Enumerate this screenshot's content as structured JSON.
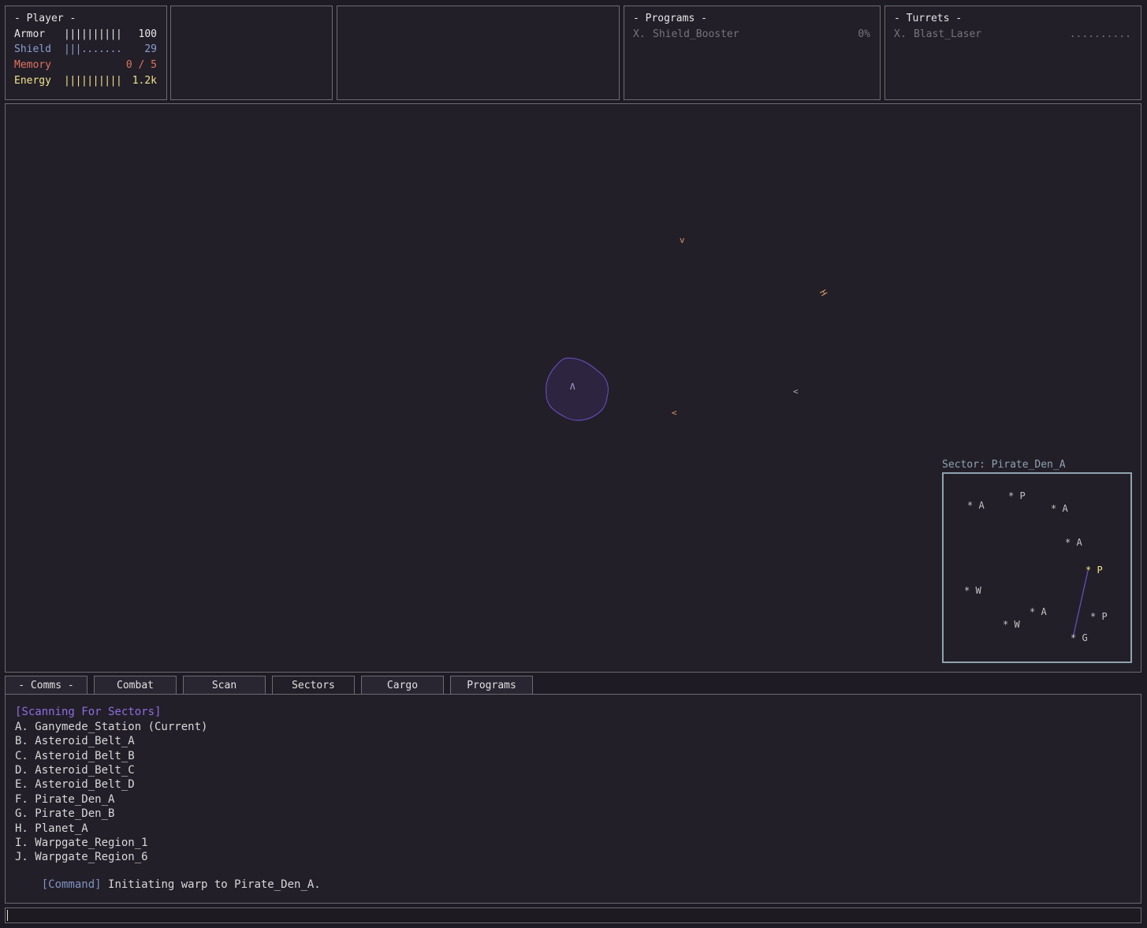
{
  "player_panel": {
    "title": "- Player -",
    "stats": [
      {
        "label": "Armor",
        "bar": "||||||||||",
        "value": "100"
      },
      {
        "label": "Shield",
        "bar": "|||.......",
        "value": "29"
      },
      {
        "label": "Memory",
        "bar": "",
        "value": "0 / 5"
      },
      {
        "label": "Energy",
        "bar": "||||||||||",
        "value": "1.2k"
      }
    ]
  },
  "programs_panel": {
    "title": "- Programs -",
    "items": [
      {
        "key": "X.",
        "name": "Shield_Booster",
        "value": "0%"
      }
    ]
  },
  "turrets_panel": {
    "title": "- Turrets -",
    "items": [
      {
        "key": "X.",
        "name": "Blast_Laser",
        "value": ".........."
      }
    ]
  },
  "viewport": {
    "player_glyph": "Λ",
    "entities": [
      {
        "glyph": "v",
        "label": "ship-1"
      },
      {
        "glyph": "H",
        "label": "ship-2"
      },
      {
        "glyph": "<",
        "label": "ship-3"
      },
      {
        "glyph": "<",
        "label": "ship-4"
      }
    ]
  },
  "minimap": {
    "sector_label": "Sector: Pirate_Den_A",
    "nodes": [
      {
        "mark": "* A"
      },
      {
        "mark": "* P"
      },
      {
        "mark": "* A"
      },
      {
        "mark": "* A"
      },
      {
        "mark": "* P"
      },
      {
        "mark": "* W"
      },
      {
        "mark": "* A"
      },
      {
        "mark": "* P"
      },
      {
        "mark": "* W"
      },
      {
        "mark": "* G"
      }
    ]
  },
  "tabs": [
    "- Comms -",
    "Combat",
    "Scan",
    "Sectors",
    "Cargo",
    "Programs"
  ],
  "active_tab": "Sectors",
  "log": {
    "header": "[Scanning For Sectors]",
    "sectors": [
      "A. Ganymede_Station (Current)",
      "B. Asteroid_Belt_A",
      "C. Asteroid_Belt_B",
      "D. Asteroid_Belt_C",
      "E. Asteroid_Belt_D",
      "F. Pirate_Den_A",
      "G. Pirate_Den_B",
      "H. Planet_A",
      "I. Warpgate_Region_1",
      "J. Warpgate_Region_6"
    ],
    "command_tag": "[Command]",
    "command_text": "Initiating warp to Pirate_Den_A."
  },
  "command_input": {
    "value": ""
  },
  "colors": {
    "armor": "#e8e8e8",
    "shield": "#8a9ed1",
    "memory": "#e0735f",
    "energy": "#f0e48a",
    "accent": "#8c6fe0",
    "player_blob": "#2d2540",
    "player_outline": "#6a52c8"
  }
}
